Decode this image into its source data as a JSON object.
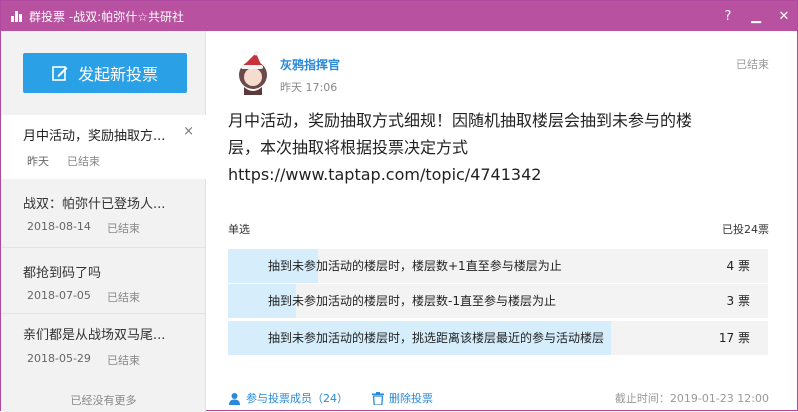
{
  "window": {
    "title": "群投票 -战双:帕弥什☆共研社",
    "controls": [
      "?",
      "▁",
      "✕"
    ]
  },
  "sidebar": {
    "new_vote_label": "发起新投票",
    "items": [
      {
        "title": "月中活动，奖励抽取方...",
        "date": "昨天",
        "status": "已结束",
        "close": "×"
      },
      {
        "title": "战双：帕弥什已登场人...",
        "date": "2018-08-14",
        "status": "已结束"
      },
      {
        "title": "都抢到码了吗",
        "date": "2018-07-05",
        "status": "已结束"
      },
      {
        "title": "亲们都是从战场双马尾...",
        "date": "2018-05-29",
        "status": "已结束"
      }
    ],
    "no_more": "已经没有更多"
  },
  "vote": {
    "author": "灰鸦指挥官",
    "time": "昨天 17:06",
    "status": "已结束",
    "question_line1": "月中活动，奖励抽取方式细规！因随机抽取楼层会抽到未参与的楼",
    "question_line2": "层，本次抽取将根据投票决定方式",
    "question_line3": "https://www.taptap.com/topic/4741342",
    "type": "单选",
    "total": "已投24票",
    "options": [
      {
        "label": "抽到未参加活动的楼层时，楼层数+1直至参与楼层为止",
        "votes_text": "4 票",
        "votes": 4
      },
      {
        "label": "抽到未参加活动的楼层时，楼层数-1直至参与楼层为止",
        "votes_text": "3 票",
        "votes": 3
      },
      {
        "label": "抽到未参加活动的楼层时，挑选距离该楼层最近的参与活动楼层",
        "votes_text": "17 票",
        "votes": 17
      }
    ],
    "total_votes": 24,
    "members_label": "参与投票成员（24）",
    "delete_label": "删除投票",
    "deadline": "截止时间：2019-01-23 12:00"
  },
  "colors": {
    "titlebar": "#b8519f",
    "accent": "#2aa0e6",
    "link": "#2a8ad8",
    "bar_fill": "#d6eefc"
  }
}
